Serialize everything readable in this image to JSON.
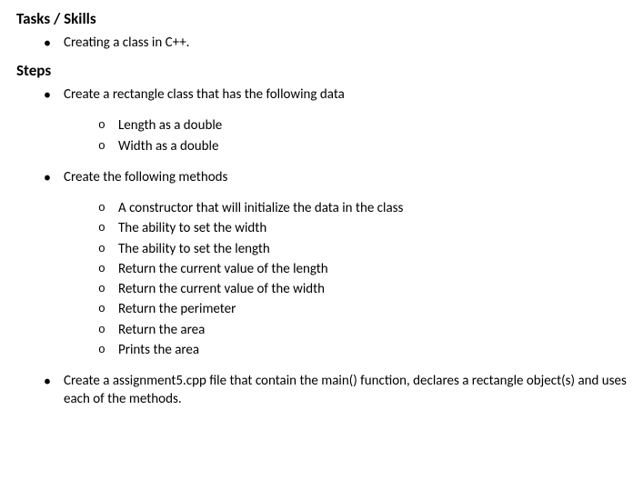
{
  "sections": {
    "tasks_skills": {
      "heading": "Tasks / Skills",
      "items": [
        {
          "text": "Creating a class in C++."
        }
      ]
    },
    "steps": {
      "heading": "Steps",
      "items": [
        {
          "text": "Create a rectangle class that has the following data",
          "subitems": [
            "Length as a double",
            "Width as a double"
          ]
        },
        {
          "text": "Create the following methods",
          "subitems": [
            "A constructor that will initialize the data in the class",
            "The ability to set the width",
            "The ability to set the length",
            "Return the current value of the length",
            "Return the current value of the width",
            "Return the perimeter",
            "Return the area",
            "Prints the area"
          ]
        },
        {
          "text": "Create a assignment5.cpp file that contain the main() function, declares a rectangle object(s) and uses each of the methods."
        }
      ]
    }
  }
}
